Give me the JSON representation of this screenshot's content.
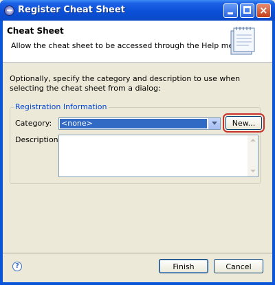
{
  "window": {
    "title": "Register Cheat Sheet"
  },
  "banner": {
    "title": "Cheat Sheet",
    "description": "Allow the cheat sheet to be accessed through the Help menu",
    "icon": "notepad-wizard-icon"
  },
  "intro": "Optionally, specify the category and description to use when selecting the cheat sheet from a dialog:",
  "group": {
    "label": "Registration Information",
    "category_label": "Category:",
    "category_value": "<none>",
    "new_button": "New...",
    "description_label": "Description:",
    "description_value": ""
  },
  "footer": {
    "finish": "Finish",
    "cancel": "Cancel",
    "help_glyph": "?"
  },
  "colors": {
    "titlebar": "#0a55d8",
    "selection": "#316ac5",
    "group_label": "#0046d5",
    "highlight": "#c8322c"
  }
}
